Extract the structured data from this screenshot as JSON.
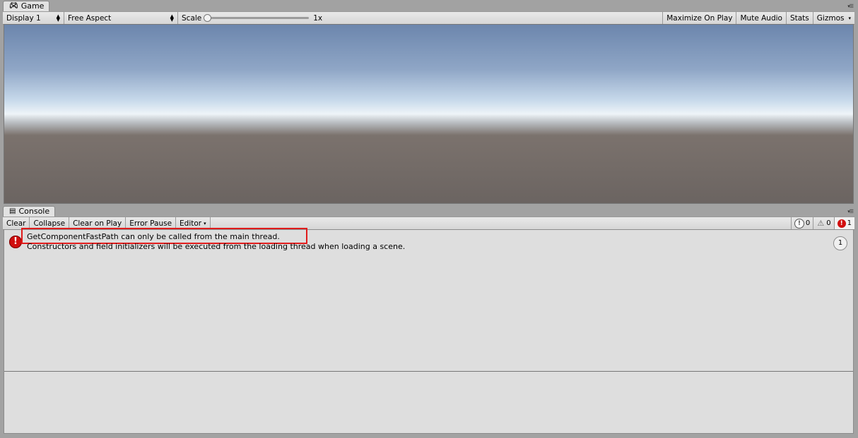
{
  "game": {
    "tab_label": "Game",
    "display": "Display 1",
    "aspect": "Free Aspect",
    "scale_label": "Scale",
    "scale_value": "1x",
    "buttons": [
      "Maximize On Play",
      "Mute Audio",
      "Stats",
      "Gizmos"
    ]
  },
  "console": {
    "tab_label": "Console",
    "buttons": [
      "Clear",
      "Collapse",
      "Clear on Play",
      "Error Pause",
      "Editor"
    ],
    "counts": {
      "info": "0",
      "warning": "0",
      "error": "1"
    },
    "log": {
      "line1": "GetComponentFastPath can only be called from the main thread.",
      "line2": "Constructors and field initializers will be executed from the loading thread when loading a scene.",
      "count": "1"
    }
  },
  "colors": {
    "error": "#d10f0f",
    "highlight": "#e01c1c"
  }
}
